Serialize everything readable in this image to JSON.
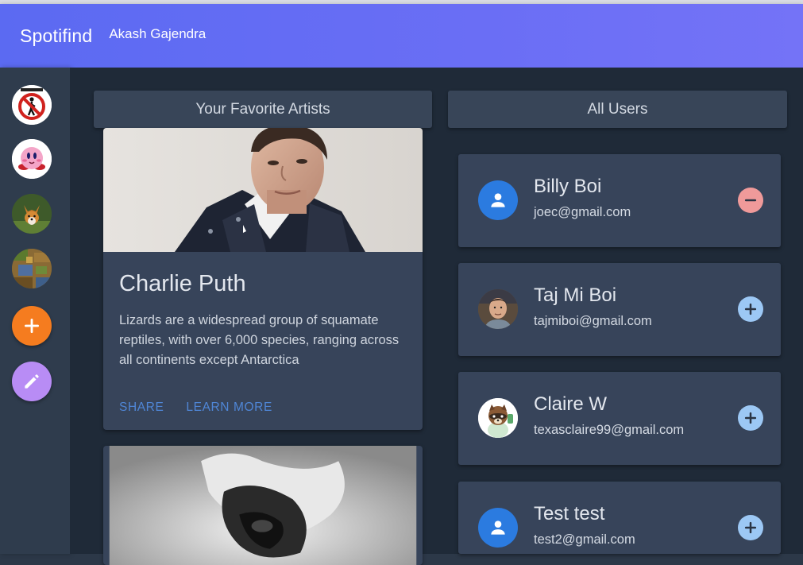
{
  "app": {
    "title": "Spotifind",
    "user_name": "Akash Gajendra",
    "accent": "#6a6ef5"
  },
  "sidebar": {
    "items": [
      {
        "icon": "no-hiking-sign-avatar"
      },
      {
        "icon": "kirby-avatar"
      },
      {
        "icon": "corgi-avatar"
      },
      {
        "icon": "pixel-map-avatar"
      },
      {
        "icon": "plus-icon",
        "color": "#f57c1f"
      },
      {
        "icon": "pencil-icon",
        "color": "#b88cf5"
      }
    ]
  },
  "favorites": {
    "header": "Your Favorite Artists",
    "cards": [
      {
        "name": "Charlie Puth",
        "description": "Lizards are a widespread group of squamate reptiles, with over 6,000 species, ranging across all continents except Antarctica",
        "actions": [
          "SHARE",
          "LEARN MORE"
        ]
      }
    ]
  },
  "users": {
    "header": "All Users",
    "list": [
      {
        "name": "Billy Boi",
        "email": "joec@gmail.com",
        "action": "remove"
      },
      {
        "name": "Taj Mi Boi",
        "email": "tajmiboi@gmail.com",
        "action": "add"
      },
      {
        "name": "Claire W",
        "email": "texasclaire99@gmail.com",
        "action": "add"
      },
      {
        "name": "Test test",
        "email": "test2@gmail.com",
        "action": "add"
      }
    ]
  }
}
